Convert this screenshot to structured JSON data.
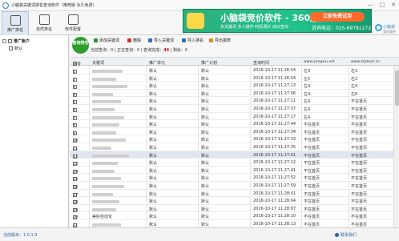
{
  "window": {
    "title": "小脑袋关键词排名查询软件（推荐版 永久免费）",
    "controls": [
      "—",
      "□",
      "✕"
    ]
  },
  "tabs": [
    {
      "label": "推广排名",
      "icon": "monitor-icon"
    },
    {
      "label": "自然排名",
      "icon": "chart-icon"
    },
    {
      "label": "软件配置",
      "icon": "book-icon"
    }
  ],
  "banner": {
    "title": "小脑袋竞价软件 - 360版",
    "subtitle": "多关键词 多人操作 时段调价 出价查询",
    "cta": "立即免费试用",
    "phone": "咨询电话：025-69781272",
    "brand_name": "小脑袋",
    "brand_sub": "竞价软件"
  },
  "tree": {
    "root": "推广账户",
    "child": "默认"
  },
  "ops": {
    "query": "查询排名",
    "add": "添加关键词",
    "delete": "删除",
    "import": "导入关键词",
    "import_rank": "导入排名",
    "export": "导出报表"
  },
  "stats": {
    "text1": "当前查询：0 | 正在查询：0 | 查询完成：",
    "done": "44",
    "text2": " | 剩余：0"
  },
  "table": {
    "headers": [
      "序号",
      "关键词",
      "推广单元",
      "推广计划",
      "查询时间",
      "www.yangxiu.net",
      "www.skytech.cn"
    ],
    "rows": [
      {
        "n": "1",
        "kw": "",
        "unit": "默认",
        "plan": "默认",
        "time": "2016-10-17 11:26:54",
        "a": "左3",
        "b": "左1"
      },
      {
        "n": "2",
        "kw": "",
        "unit": "默认",
        "plan": "默认",
        "time": "2016-10-17 11:26:54",
        "a": "左5",
        "b": "左2"
      },
      {
        "n": "3",
        "kw": "",
        "unit": "默认",
        "plan": "默认",
        "time": "2016-10-17 11:27:13",
        "a": "左4",
        "b": "左4"
      },
      {
        "n": "4",
        "kw": "",
        "unit": "默认",
        "plan": "默认",
        "time": "2016-10-17 11:27:06",
        "a": "左4",
        "b": "左6"
      },
      {
        "n": "5",
        "kw": "",
        "unit": "默认",
        "plan": "默认",
        "time": "2016-10-17 11:27:11",
        "a": "左4",
        "b": "不在首页"
      },
      {
        "n": "6",
        "kw": "",
        "unit": "默认",
        "plan": "默认",
        "time": "2016-10-17 11:27:37",
        "a": "左4",
        "b": "不在首页"
      },
      {
        "n": "7",
        "kw": "",
        "unit": "默认",
        "plan": "默认",
        "time": "2016-10-17 11:27:17",
        "a": "左4",
        "b": "不在首页"
      },
      {
        "n": "8",
        "kw": "",
        "unit": "默认",
        "plan": "默认",
        "time": "2016-10-17 11:27:44",
        "a": "不在首页",
        "b": "不在首页"
      },
      {
        "n": "9",
        "kw": "",
        "unit": "默认",
        "plan": "默认",
        "time": "2016-10-17 11:27:34",
        "a": "不在首页",
        "b": "不在首页"
      },
      {
        "n": "10",
        "kw": "",
        "unit": "默认",
        "plan": "默认",
        "time": "2016-10-17 11:27:33",
        "a": "不在首页",
        "b": "不在首页"
      },
      {
        "n": "11",
        "kw": "",
        "unit": "默认",
        "plan": "默认",
        "time": "2016-10-17 11:27:35",
        "a": "不在首页",
        "b": "不在首页"
      },
      {
        "n": "12",
        "kw": "",
        "unit": "默认",
        "plan": "默认",
        "time": "2016-10-17 11:27:41",
        "a": "不在首页",
        "b": "不在首页",
        "selected": true
      },
      {
        "n": "13",
        "kw": "",
        "unit": "默认",
        "plan": "默认",
        "time": "2016-10-17 11:27:12",
        "a": "不在首页",
        "b": "不在首页"
      },
      {
        "n": "14",
        "kw": "",
        "unit": "默认",
        "plan": "默认",
        "time": "2016-10-17 11:27:41",
        "a": "不在首页",
        "b": "不在首页"
      },
      {
        "n": "15",
        "kw": "",
        "unit": "默认",
        "plan": "默认",
        "time": "2016-10-17 11:27:52",
        "a": "不在首页",
        "b": "不在首页"
      },
      {
        "n": "16",
        "kw": "",
        "unit": "默认",
        "plan": "默认",
        "time": "2016-10-17 11:27:59",
        "a": "不在首页",
        "b": "不在首页"
      },
      {
        "n": "17",
        "kw": "",
        "unit": "默认",
        "plan": "默认",
        "time": "2016-10-17 11:28:01",
        "a": "不在首页",
        "b": "不在首页"
      },
      {
        "n": "18",
        "kw": "",
        "unit": "默认",
        "plan": "默认",
        "time": "2016-10-17 11:28:04",
        "a": "不在首页",
        "b": "不在首页"
      },
      {
        "n": "19",
        "kw": "",
        "unit": "默认",
        "plan": "默认",
        "time": "2016-10-17 11:28:07",
        "a": "不在首页",
        "b": "不在首页"
      },
      {
        "n": "20",
        "kw": "美好自动化",
        "unit": "默认",
        "plan": "默认",
        "time": "2016-10-17 11:28:10",
        "a": "不在首页",
        "b": "不在首页"
      },
      {
        "n": "21",
        "kw": "",
        "unit": "默认",
        "plan": "默认",
        "time": "2016-10-17 11:28:13",
        "a": "不在首页",
        "b": "不在首页"
      }
    ]
  },
  "status": {
    "version": "当前版本：1.0.1.0",
    "contact": "联系我们"
  }
}
